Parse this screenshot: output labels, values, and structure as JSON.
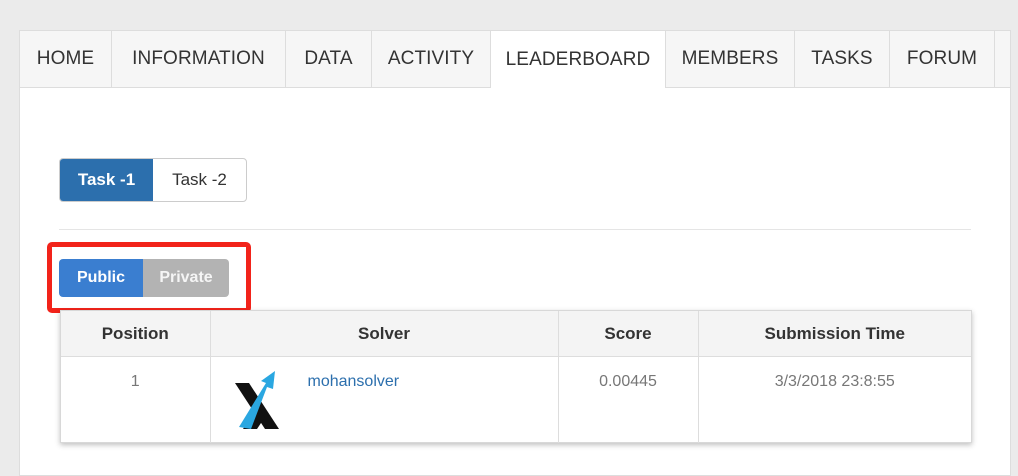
{
  "tabs": [
    {
      "label": "HOME"
    },
    {
      "label": "INFORMATION"
    },
    {
      "label": "DATA"
    },
    {
      "label": "ACTIVITY"
    },
    {
      "label": "LEADERBOARD"
    },
    {
      "label": "MEMBERS"
    },
    {
      "label": "TASKS"
    },
    {
      "label": "FORUM"
    }
  ],
  "active_tab": "LEADERBOARD",
  "task_selector": {
    "options": [
      "Task -1",
      "Task -2"
    ],
    "selected": "Task -1"
  },
  "visibility_toggle": {
    "public_label": "Public",
    "private_label": "Private",
    "selected": "Public"
  },
  "leaderboard": {
    "columns": [
      "Position",
      "Solver",
      "Score",
      "Submission Time"
    ],
    "rows": [
      {
        "position": "1",
        "solver": "mohansolver",
        "score": "0.00445",
        "submission_time": "3/3/2018 23:8:55"
      }
    ]
  },
  "colors": {
    "primary": "#2c6fad",
    "public_button": "#3a7ed0",
    "private_button": "#b3b3b3",
    "highlight_border": "#f2231a",
    "logo_blue": "#2aa7e1"
  },
  "icons": {
    "solver_avatar": "x-arrow-logo"
  }
}
